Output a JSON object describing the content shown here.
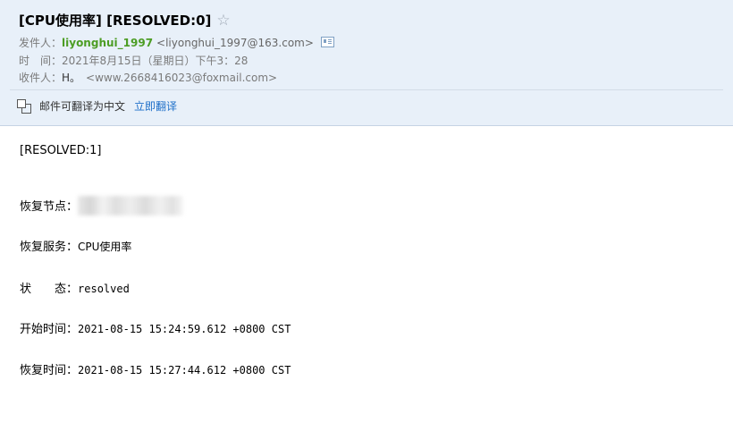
{
  "email": {
    "subject": "[CPU使用率] [RESOLVED:0]",
    "star_icon": "star-outline-icon",
    "from_label": "发件人：",
    "from_name": "liyonghui_1997",
    "from_email": "<liyonghui_1997@163.com>",
    "contact_card_icon": "contact-card-icon",
    "time_label": "时　间：",
    "time_value": "2021年8月15日（星期日）下午3：28",
    "to_label": "收件人：",
    "to_name": "H。",
    "to_email": "<www.2668416023@foxmail.com>"
  },
  "translate": {
    "icon": "translate-icon",
    "text": "邮件可翻译为中文",
    "link": "立即翻译"
  },
  "body": {
    "resolved": "[RESOLVED:1]",
    "node_label": "恢复节点：",
    "service_label": "恢复服务：",
    "service_value": "CPU使用率",
    "status_label": "状　　态：",
    "status_value": "resolved",
    "start_label": "开始时间：",
    "start_value": "2021-08-15 15:24:59.612 +0800 CST",
    "recover_label": "恢复时间：",
    "recover_value": "2021-08-15 15:27:44.612 +0800 CST"
  },
  "colors": {
    "header_bg": "#e8f0f9",
    "sender_name": "#4c9d24",
    "link": "#1e6fc9"
  }
}
